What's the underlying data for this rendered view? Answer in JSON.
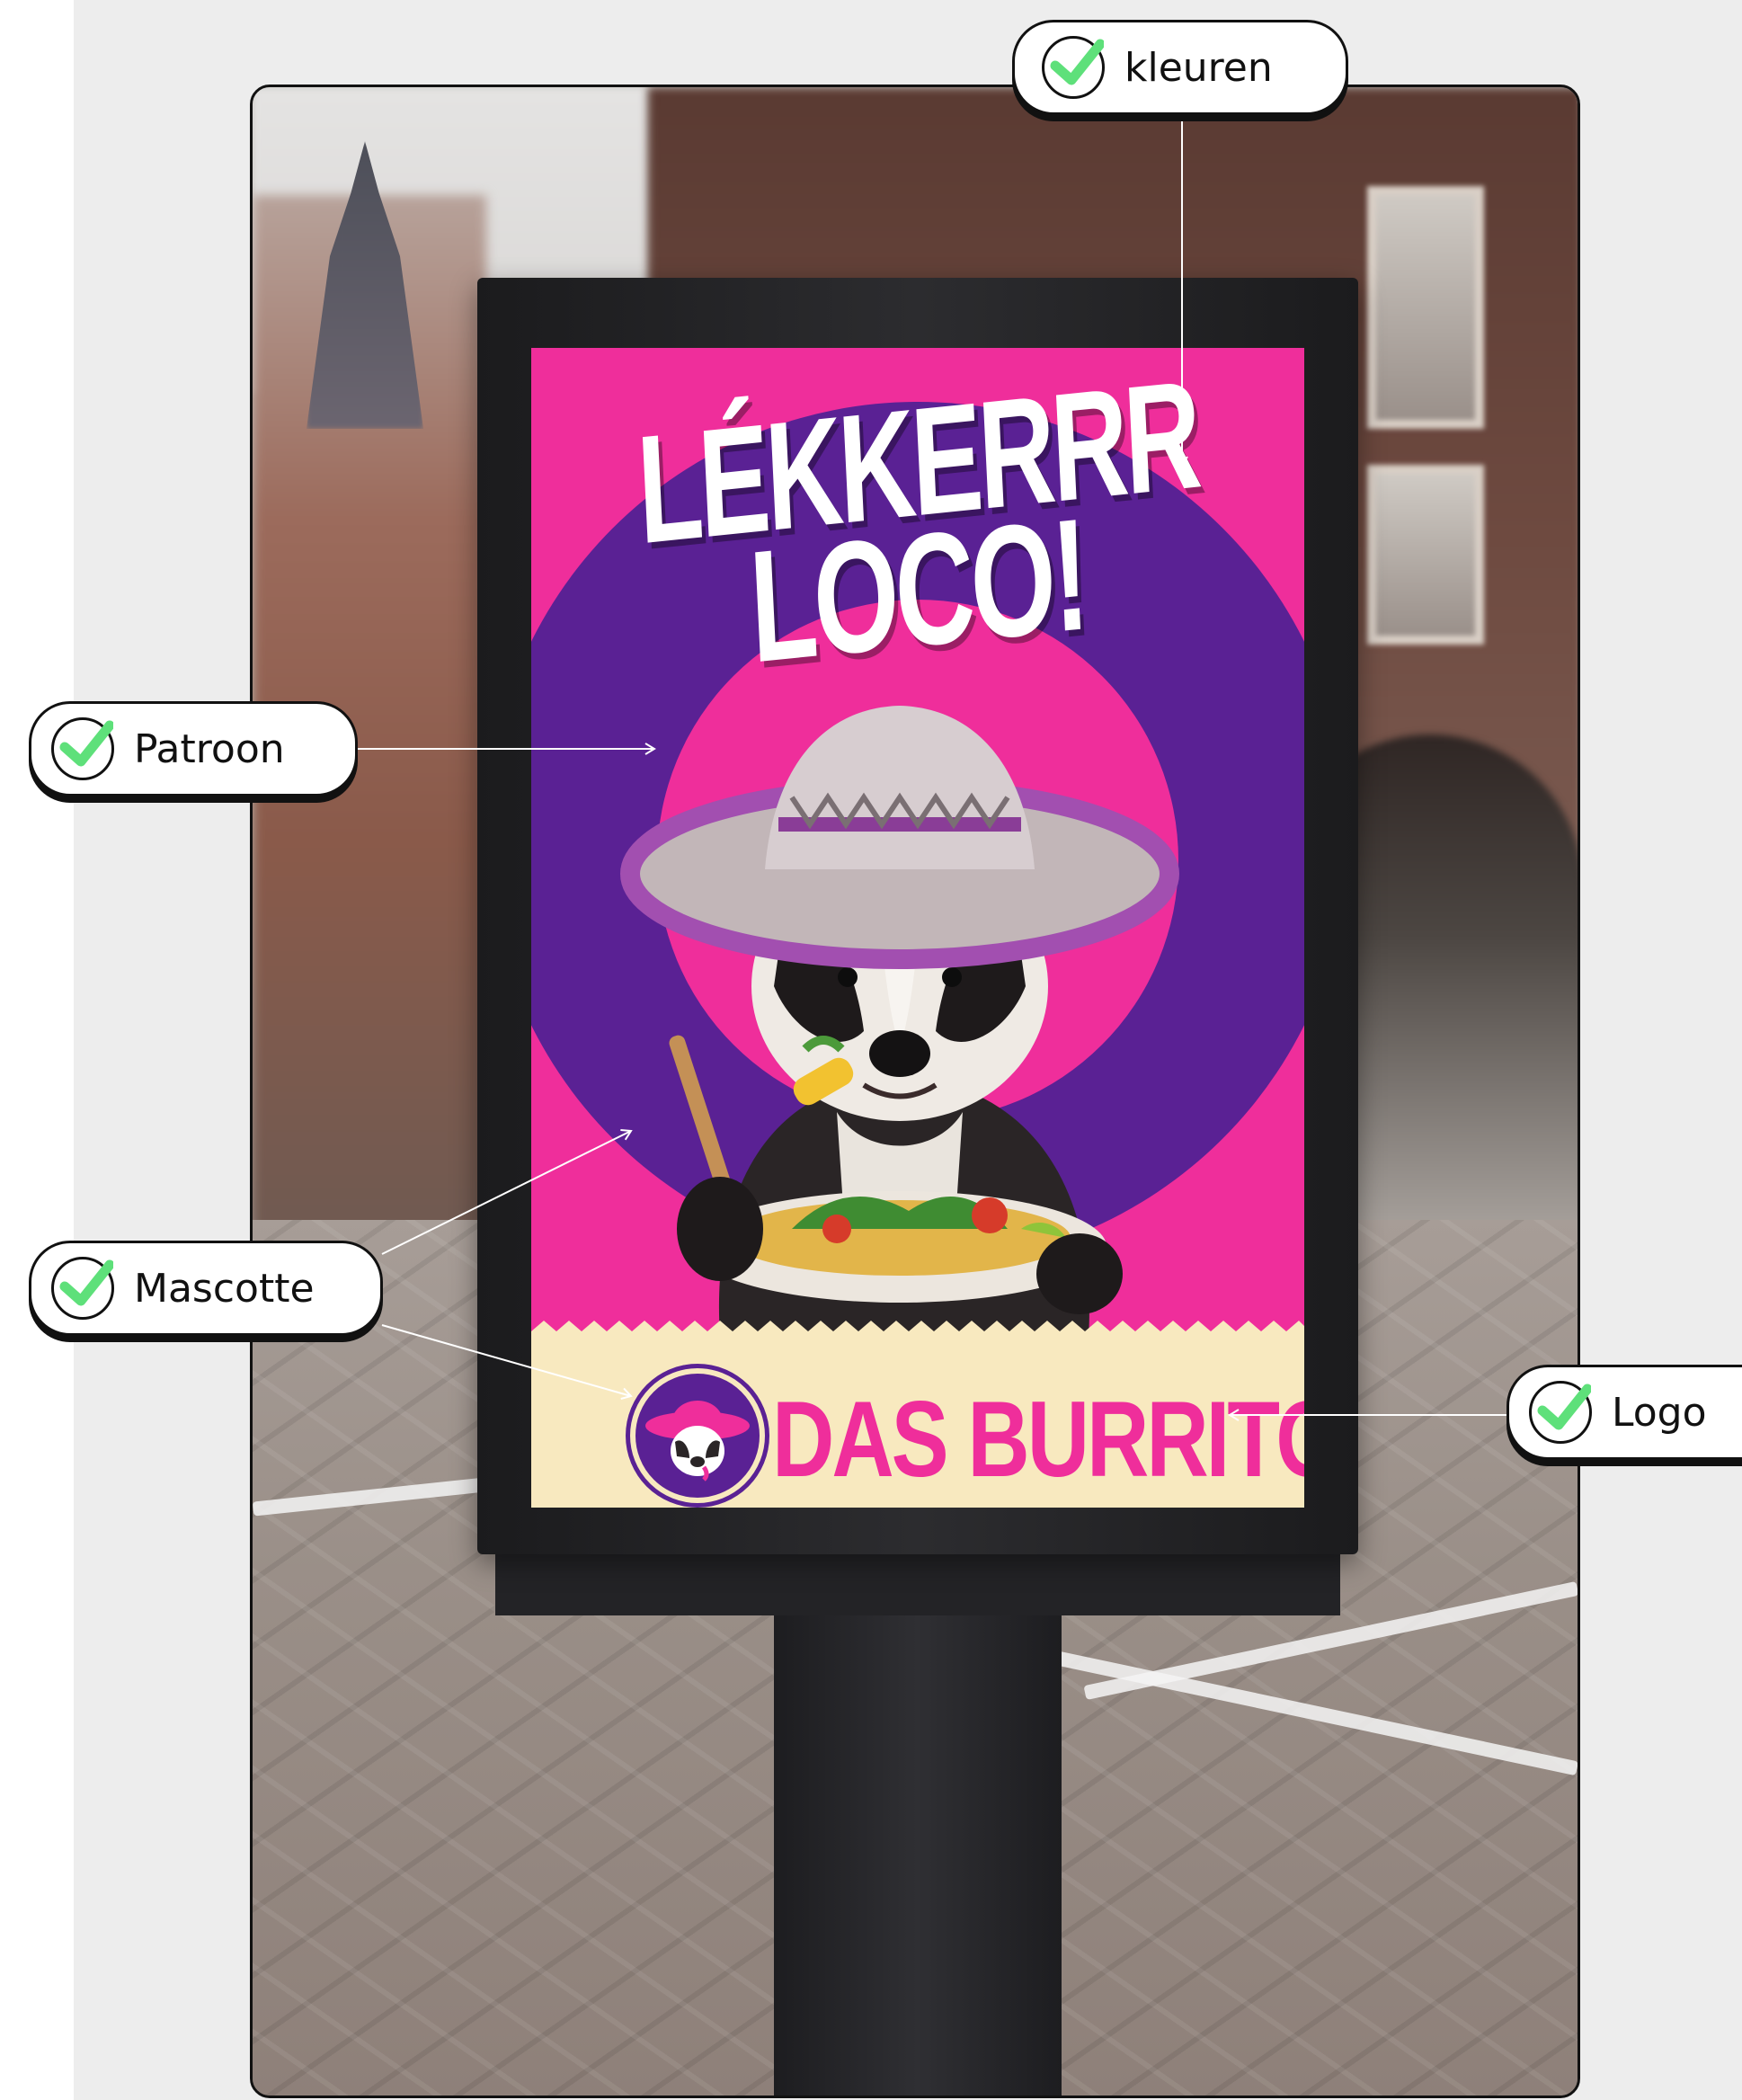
{
  "poster": {
    "headline_line1": "LÉKKERRR",
    "headline_line2": "LOCO!",
    "brand_name": "DAS BURRITO'S"
  },
  "callouts": {
    "kleuren": "kleuren",
    "patroon": "Patroon",
    "mascotte": "Mascotte",
    "logo": "Logo"
  },
  "colors": {
    "accent_pink": "#ef2e9b",
    "accent_purple": "#5a2194",
    "check_green": "#5ee07a",
    "footer_cream": "#f8e9bf"
  }
}
